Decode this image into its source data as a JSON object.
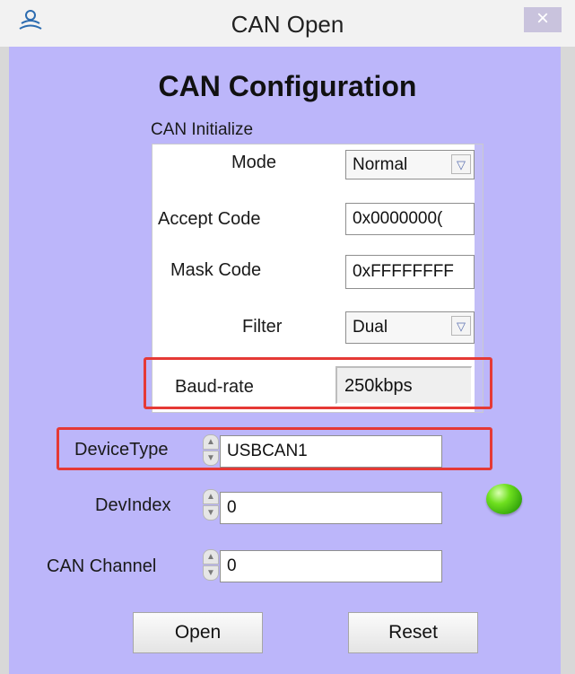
{
  "window": {
    "title": "CAN Open",
    "close_symbol": "×",
    "icon": "app-logo-icon"
  },
  "main": {
    "heading": "CAN Configuration",
    "group_label": "CAN Initialize"
  },
  "can_init": {
    "mode_label": "Mode",
    "mode_value": "Normal",
    "accept_code_label": "Accept Code",
    "accept_code_value": "0x0000000(",
    "mask_code_label": "Mask Code",
    "mask_code_value": "0xFFFFFFFF",
    "filter_label": "Filter",
    "filter_value": "Dual",
    "baud_rate_label": "Baud-rate",
    "baud_rate_value": "250kbps"
  },
  "device": {
    "device_type_label": "DeviceType",
    "device_type_value": "USBCAN1",
    "dev_index_label": "DevIndex",
    "dev_index_value": "0",
    "can_channel_label": "CAN Channel",
    "can_channel_value": "0"
  },
  "status": {
    "led_color": "#4cc81a",
    "led_icon": "status-led-icon"
  },
  "buttons": {
    "open_label": "Open",
    "reset_label": "Reset"
  },
  "colors": {
    "panel_background": "#bcb6fa",
    "highlight": "#e53935"
  }
}
